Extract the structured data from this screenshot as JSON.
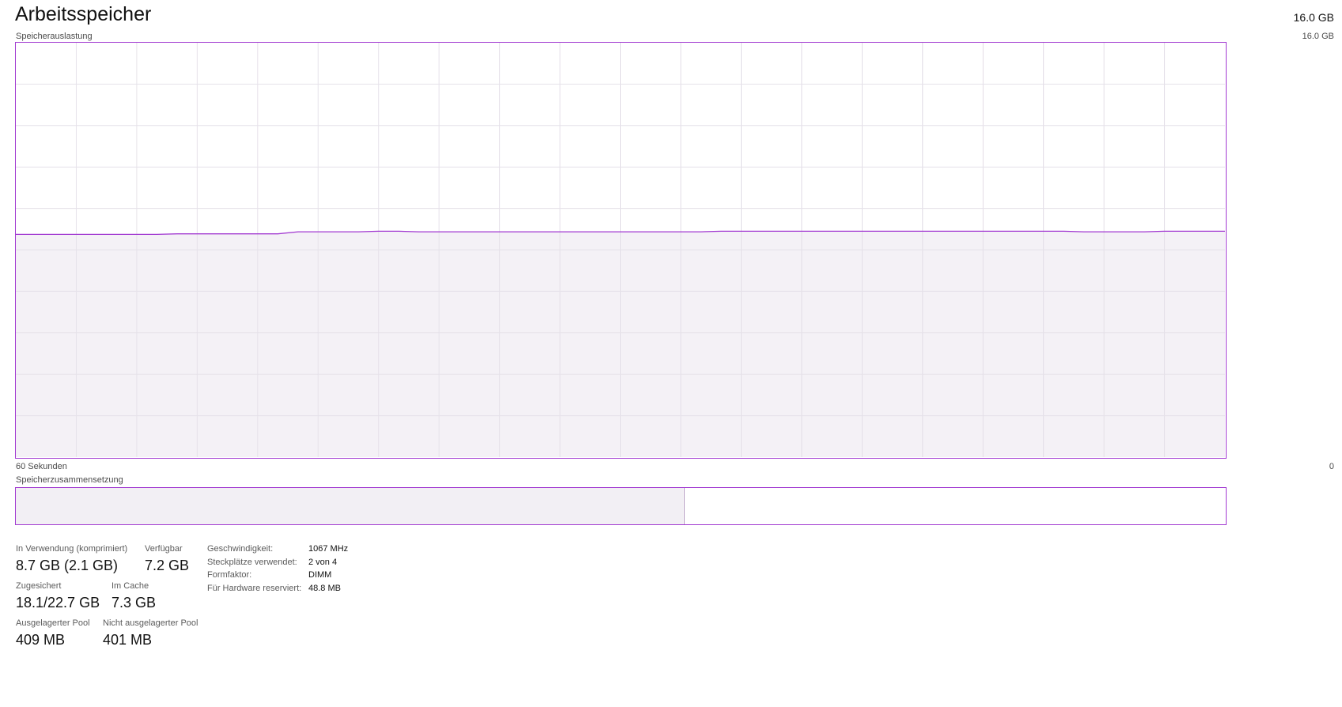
{
  "header": {
    "title": "Arbeitsspeicher",
    "total": "16.0 GB"
  },
  "usage_graph": {
    "caption": "Speicherauslastung",
    "max_label": "16.0 GB",
    "time_left": "60 Sekunden",
    "time_right": "0",
    "colors": {
      "line": "#a23ad1",
      "fill": "#f2eff4",
      "grid": "#e6e2ea"
    },
    "series": [
      {
        "values": [
          8.6,
          8.6,
          8.6,
          8.6,
          8.6,
          8.6,
          8.6,
          8.6,
          8.62,
          8.62,
          8.62,
          8.62,
          8.62,
          8.62,
          8.7,
          8.7,
          8.7,
          8.7,
          8.72,
          8.72,
          8.7,
          8.7,
          8.7,
          8.7,
          8.7,
          8.7,
          8.7,
          8.7,
          8.7,
          8.7,
          8.7,
          8.7,
          8.7,
          8.7,
          8.7,
          8.72,
          8.72,
          8.72,
          8.72,
          8.72,
          8.72,
          8.72,
          8.72,
          8.72,
          8.72,
          8.72,
          8.72,
          8.72,
          8.72,
          8.72,
          8.72,
          8.72,
          8.72,
          8.7,
          8.7,
          8.7,
          8.7,
          8.72,
          8.72,
          8.72,
          8.72
        ]
      }
    ],
    "ylim": [
      0,
      16
    ]
  },
  "composition": {
    "caption": "Speicherzusammensetzung",
    "used_fraction": 0.545,
    "modified_fraction": 0.007
  },
  "stats": [
    {
      "label": "In Verwendung (komprimiert)",
      "value": "8.7 GB (2.1 GB)"
    },
    {
      "label": "Verfügbar",
      "value": "7.2 GB"
    },
    {
      "label": "Zugesichert",
      "value": "18.1/22.7 GB"
    },
    {
      "label": "Im Cache",
      "value": "7.3 GB"
    },
    {
      "label": "Ausgelagerter Pool",
      "value": "409 MB"
    },
    {
      "label": "Nicht ausgelagerter Pool",
      "value": "401 MB"
    }
  ],
  "specs": [
    {
      "key": "Geschwindigkeit:",
      "value": "1067 MHz"
    },
    {
      "key": "Steckplätze verwendet:",
      "value": "2 von 4"
    },
    {
      "key": "Formfaktor:",
      "value": "DIMM"
    },
    {
      "key": "Für Hardware reserviert:",
      "value": "48.8 MB"
    }
  ]
}
